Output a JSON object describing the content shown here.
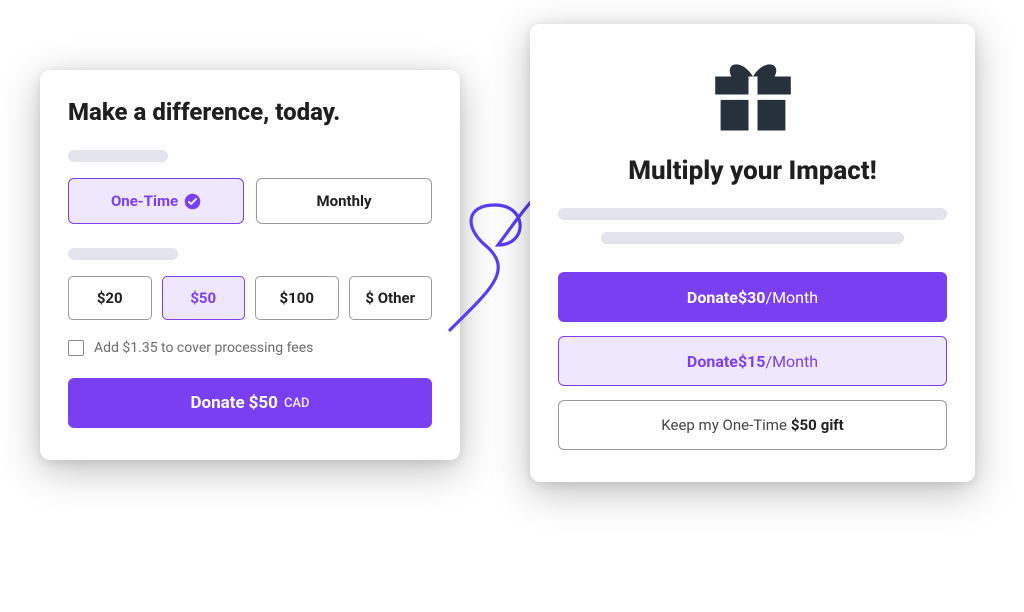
{
  "colors": {
    "accent": "#7b3ff2",
    "accent_light": "#efe7fc"
  },
  "left": {
    "title": "Make a difference, today.",
    "frequency": {
      "options": [
        {
          "label": "One-Time",
          "selected": true
        },
        {
          "label": "Monthly",
          "selected": false
        }
      ]
    },
    "amounts": [
      {
        "label": "$20",
        "selected": false
      },
      {
        "label": "$50",
        "selected": true
      },
      {
        "label": "$100",
        "selected": false
      },
      {
        "label": "$ Other",
        "selected": false
      }
    ],
    "fee_checkbox": {
      "checked": false,
      "label": "Add $1.35 to cover processing fees"
    },
    "submit": {
      "prefix": "Donate ",
      "amount": "$50",
      "currency": "CAD"
    }
  },
  "right": {
    "icon": "gift-icon",
    "title": "Multiply your Impact!",
    "option_primary": {
      "prefix": "Donate ",
      "amount": "$30",
      "suffix": "/Month"
    },
    "option_secondary": {
      "prefix": "Donate ",
      "amount": "$15",
      "suffix": "/Month"
    },
    "keep": {
      "prefix": "Keep my One-Time ",
      "amount": "$50",
      "suffix": " gift"
    }
  }
}
